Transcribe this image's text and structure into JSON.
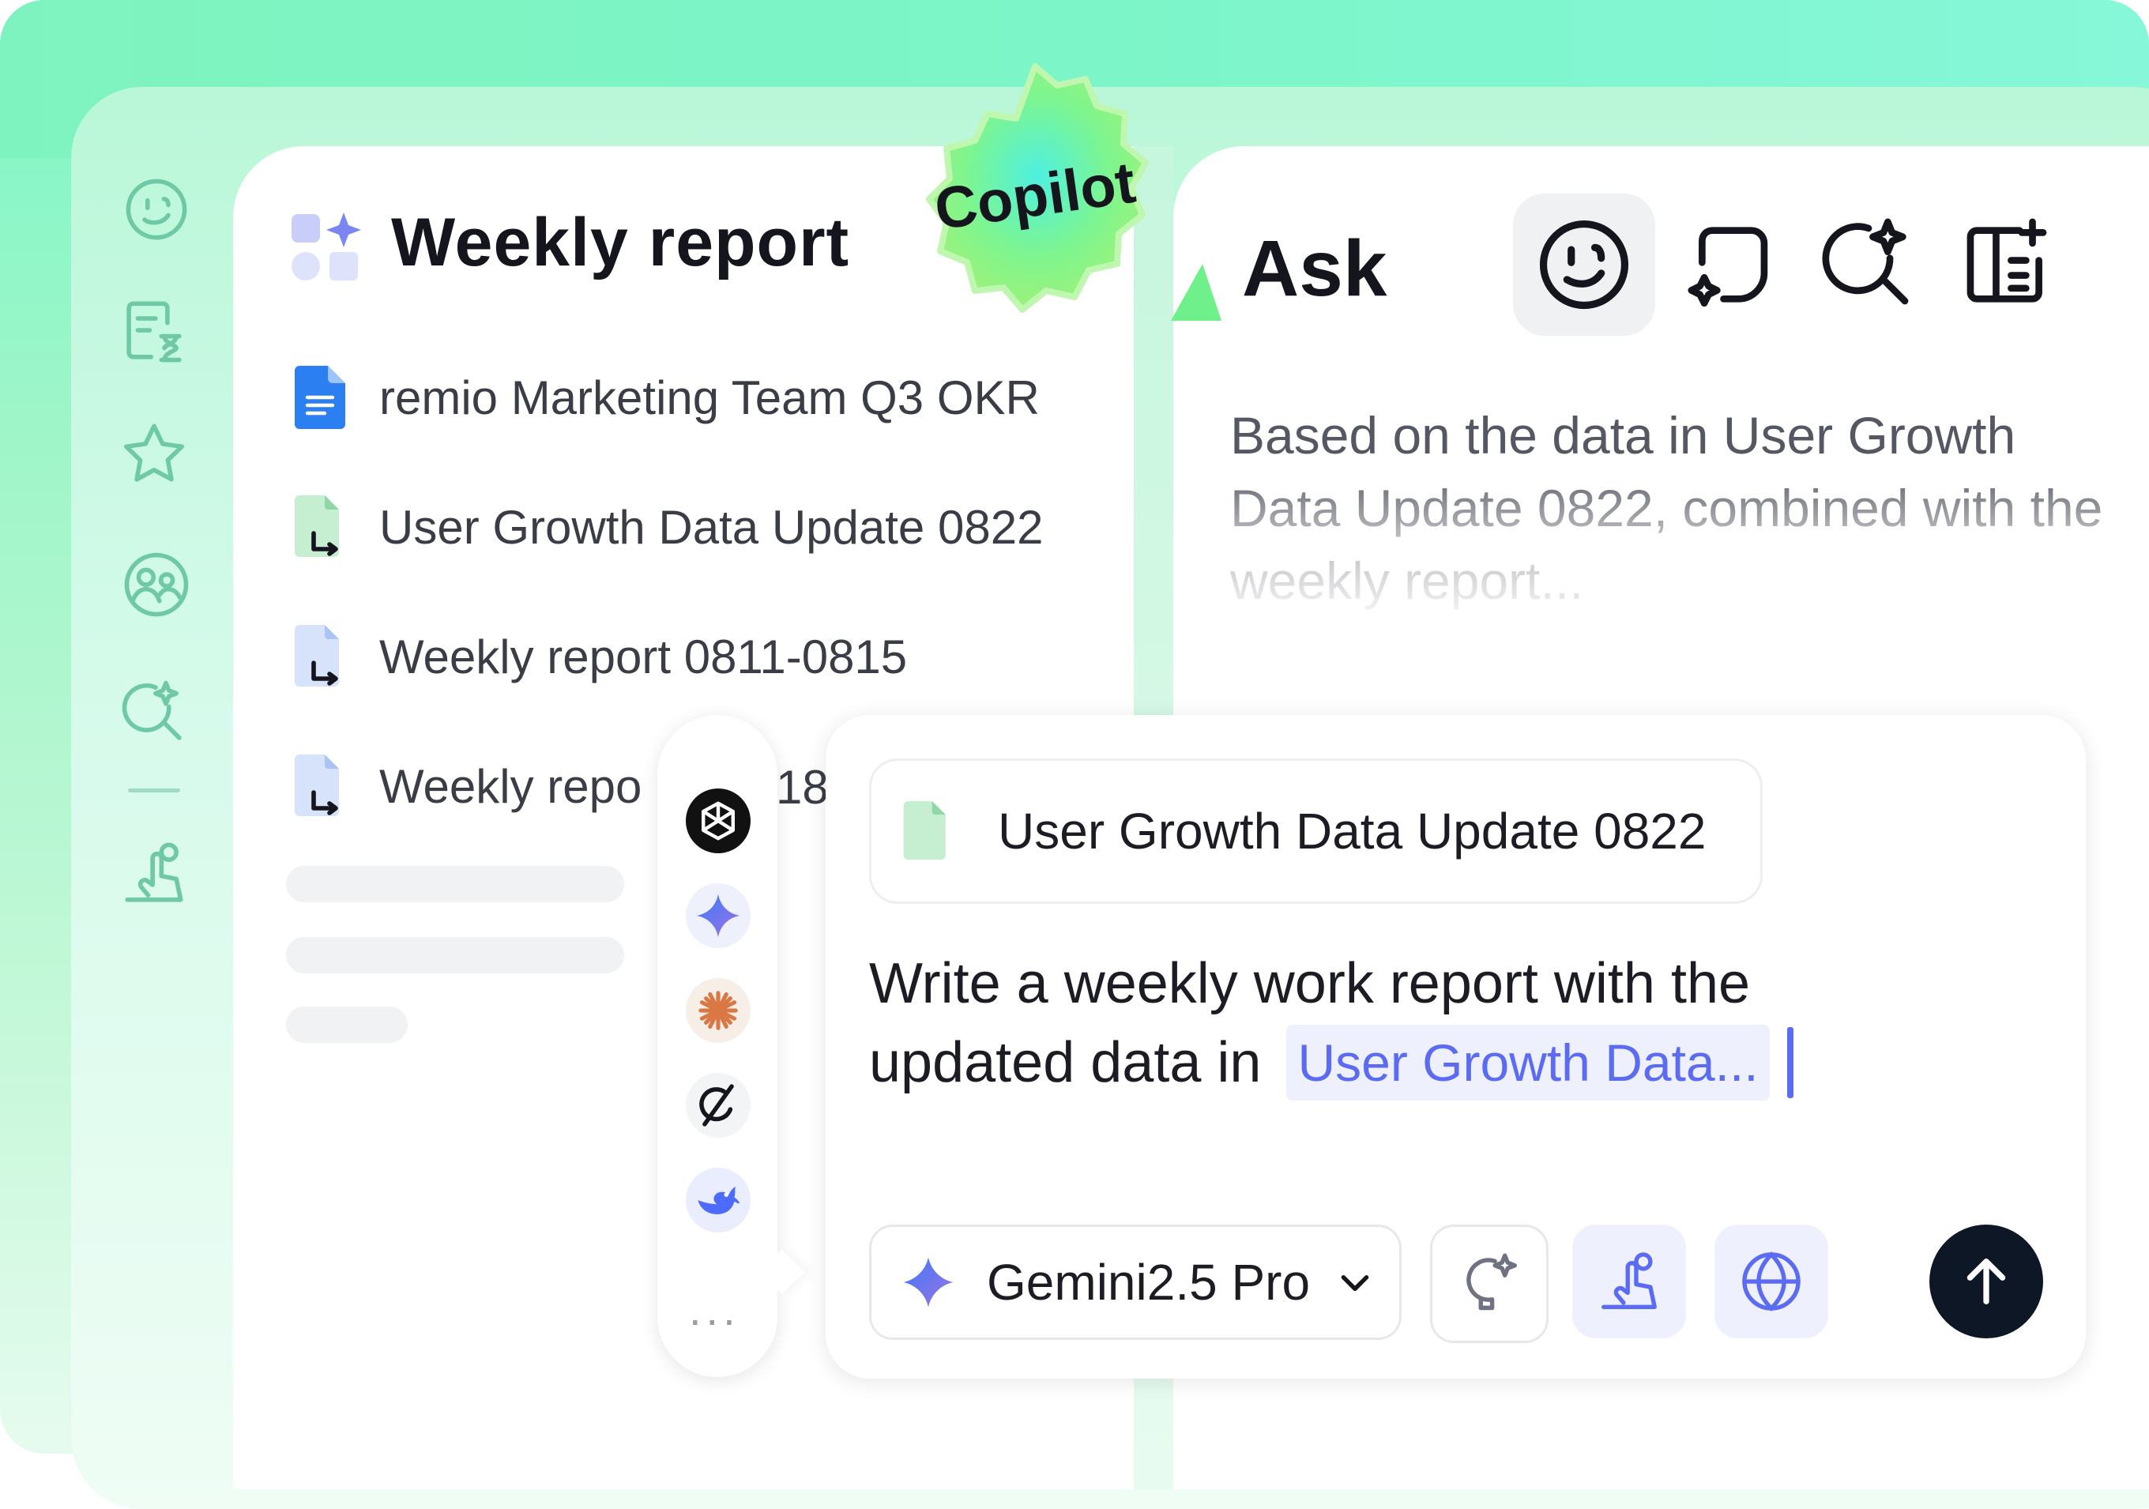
{
  "sidebar": {
    "icons": [
      "smile-face-icon",
      "doc-timer-icon",
      "star-icon",
      "people-group-icon",
      "ai-search-icon",
      "cursor-click-icon"
    ]
  },
  "badge": {
    "label": "Copilot"
  },
  "left_panel": {
    "title": "Weekly report",
    "documents": [
      {
        "label": "remio Marketing Team Q3 OKR",
        "icon": "google-doc-icon"
      },
      {
        "label": "User Growth Data Update 0822",
        "icon": "linked-sheet-icon"
      },
      {
        "label": "Weekly report 0811-0815",
        "icon": "linked-doc-icon"
      },
      {
        "label": "Weekly repo",
        "label_tail": "18",
        "icon": "linked-doc-icon"
      }
    ]
  },
  "right_panel": {
    "title": "Ask",
    "tools": [
      "ask-face-icon",
      "ai-note-icon",
      "ai-search-icon",
      "panel-add-icon"
    ],
    "answer_preview": "Based on the data in User Growth Data Update 0822, combined with the weekly report..."
  },
  "models": [
    "chatgpt-logo-icon",
    "gemini-logo-icon",
    "claude-logo-icon",
    "grok-logo-icon",
    "deepseek-logo-icon"
  ],
  "more_label": "...",
  "composer": {
    "attachment_label": "User Growth Data Update 0822",
    "prompt_line1": "Write a weekly work report with the",
    "prompt_line2": "updated data in",
    "mention": "User Growth Data...",
    "model_selector": "Gemini2.5 Pro"
  },
  "colors": {
    "accent": "#5b6cf2",
    "mint": "#7df7c8",
    "send": "#0e1725"
  }
}
